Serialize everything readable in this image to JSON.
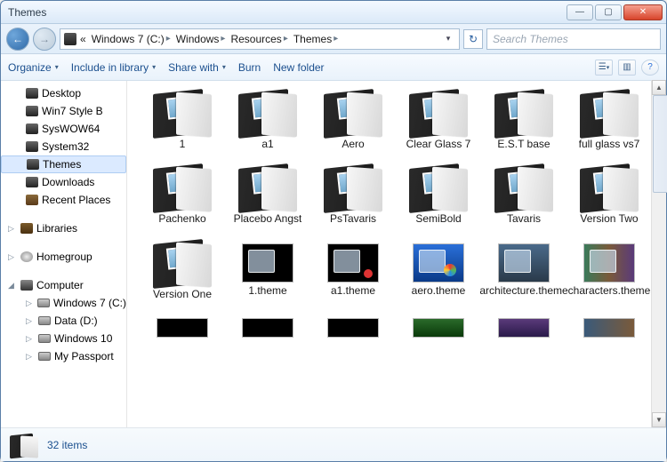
{
  "window": {
    "title": "Themes"
  },
  "nav": {
    "breadcrumb_prefix": "«",
    "crumbs": [
      "Windows 7 (C:)",
      "Windows",
      "Resources",
      "Themes"
    ],
    "search_placeholder": "Search Themes"
  },
  "toolbar": {
    "organize": "Organize",
    "include": "Include in library",
    "share": "Share with",
    "burn": "Burn",
    "newfolder": "New folder"
  },
  "sidebar": {
    "items": [
      {
        "label": "Desktop",
        "icon": "folder"
      },
      {
        "label": "Win7 Style B",
        "icon": "folder"
      },
      {
        "label": "SysWOW64",
        "icon": "folder"
      },
      {
        "label": "System32",
        "icon": "folder"
      },
      {
        "label": "Themes",
        "icon": "folder",
        "selected": true
      },
      {
        "label": "Downloads",
        "icon": "folder"
      },
      {
        "label": "Recent Places",
        "icon": "recent"
      }
    ],
    "libraries": "Libraries",
    "homegroup": "Homegroup",
    "computer": "Computer",
    "drives": [
      {
        "label": "Windows 7 (C:)"
      },
      {
        "label": "Data (D:)"
      },
      {
        "label": "Windows 10"
      },
      {
        "label": "My Passport"
      }
    ]
  },
  "items": {
    "row1": [
      {
        "label": "1",
        "type": "folder"
      },
      {
        "label": "a1",
        "type": "folder"
      },
      {
        "label": "Aero",
        "type": "folder"
      },
      {
        "label": "Clear Glass 7",
        "type": "folder"
      },
      {
        "label": "E.S.T  base",
        "type": "folder"
      },
      {
        "label": "full glass vs7",
        "type": "folder"
      }
    ],
    "row2": [
      {
        "label": "Pachenko",
        "type": "folder"
      },
      {
        "label": "Placebo Angst",
        "type": "folder"
      },
      {
        "label": "PsTavaris",
        "type": "folder"
      },
      {
        "label": "SemiBold",
        "type": "folder"
      },
      {
        "label": "Tavaris",
        "type": "folder"
      },
      {
        "label": "Version  Two",
        "type": "folder"
      }
    ],
    "row3": [
      {
        "label": "Version One",
        "type": "folder"
      },
      {
        "label": "1.theme",
        "type": "theme",
        "variant": "dark"
      },
      {
        "label": "a1.theme",
        "type": "theme",
        "variant": "a1"
      },
      {
        "label": "aero.theme",
        "type": "theme",
        "variant": "aero"
      },
      {
        "label": "architecture.theme",
        "type": "theme",
        "variant": "arch"
      },
      {
        "label": "characters.theme",
        "type": "theme",
        "variant": "char"
      }
    ]
  },
  "status": {
    "count": "32 items"
  }
}
